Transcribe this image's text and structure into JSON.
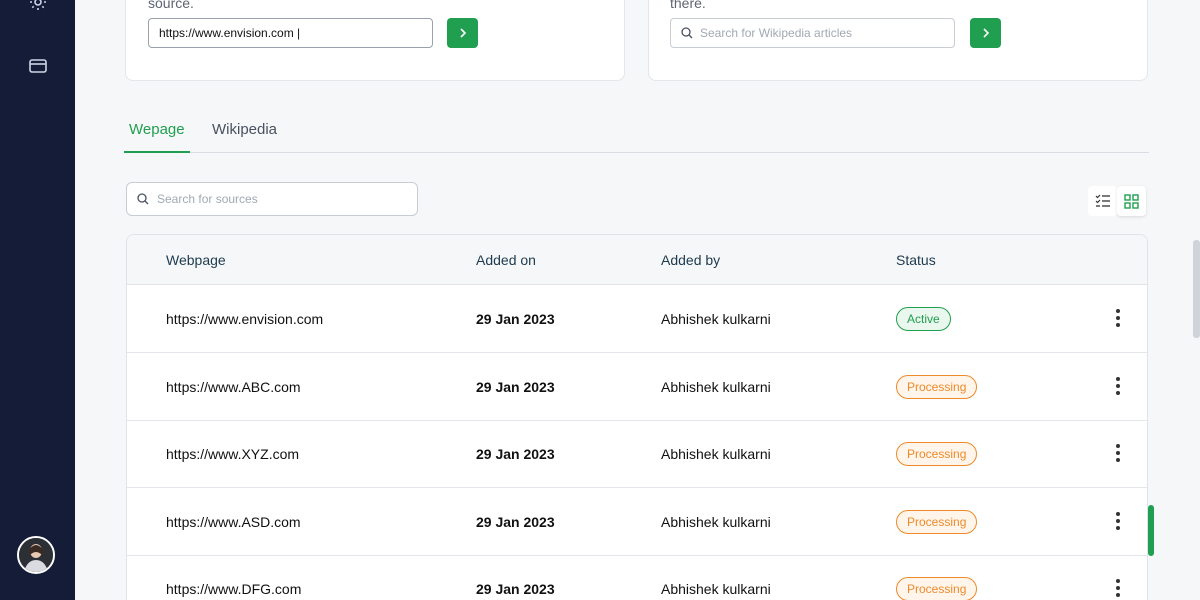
{
  "sidebar": {
    "icons": [
      "settings-gear-icon",
      "credit-card-icon"
    ],
    "avatar": "user-avatar"
  },
  "webpage_card": {
    "text": "source.",
    "input_value": "https://www.envision.com |"
  },
  "wikipedia_card": {
    "text": "there.",
    "input_placeholder": "Search for Wikipedia articles"
  },
  "tabs": [
    {
      "label": "Wepage",
      "active": true
    },
    {
      "label": "Wikipedia",
      "active": false
    }
  ],
  "search": {
    "placeholder": "Search for sources"
  },
  "view_toggle": {
    "active": "grid"
  },
  "table": {
    "headers": [
      "Webpage",
      "Added on",
      "Added by",
      "Status"
    ],
    "rows": [
      {
        "webpage": "https://www.envision.com",
        "added_on": "29 Jan 2023",
        "added_by": "Abhishek kulkarni",
        "status": "Active"
      },
      {
        "webpage": "https://www.ABC.com",
        "added_on": "29 Jan 2023",
        "added_by": "Abhishek kulkarni",
        "status": "Processing"
      },
      {
        "webpage": "https://www.XYZ.com",
        "added_on": "29 Jan 2023",
        "added_by": "Abhishek kulkarni",
        "status": "Processing"
      },
      {
        "webpage": "https://www.ASD.com",
        "added_on": "29 Jan 2023",
        "added_by": "Abhishek kulkarni",
        "status": "Processing"
      },
      {
        "webpage": "https://www.DFG.com",
        "added_on": "29 Jan 2023",
        "added_by": "Abhishek kulkarni",
        "status": "Processing"
      }
    ]
  },
  "colors": {
    "accent": "#1f9f4f",
    "sidebar": "#141c38",
    "processing": "#ee8a2a"
  }
}
